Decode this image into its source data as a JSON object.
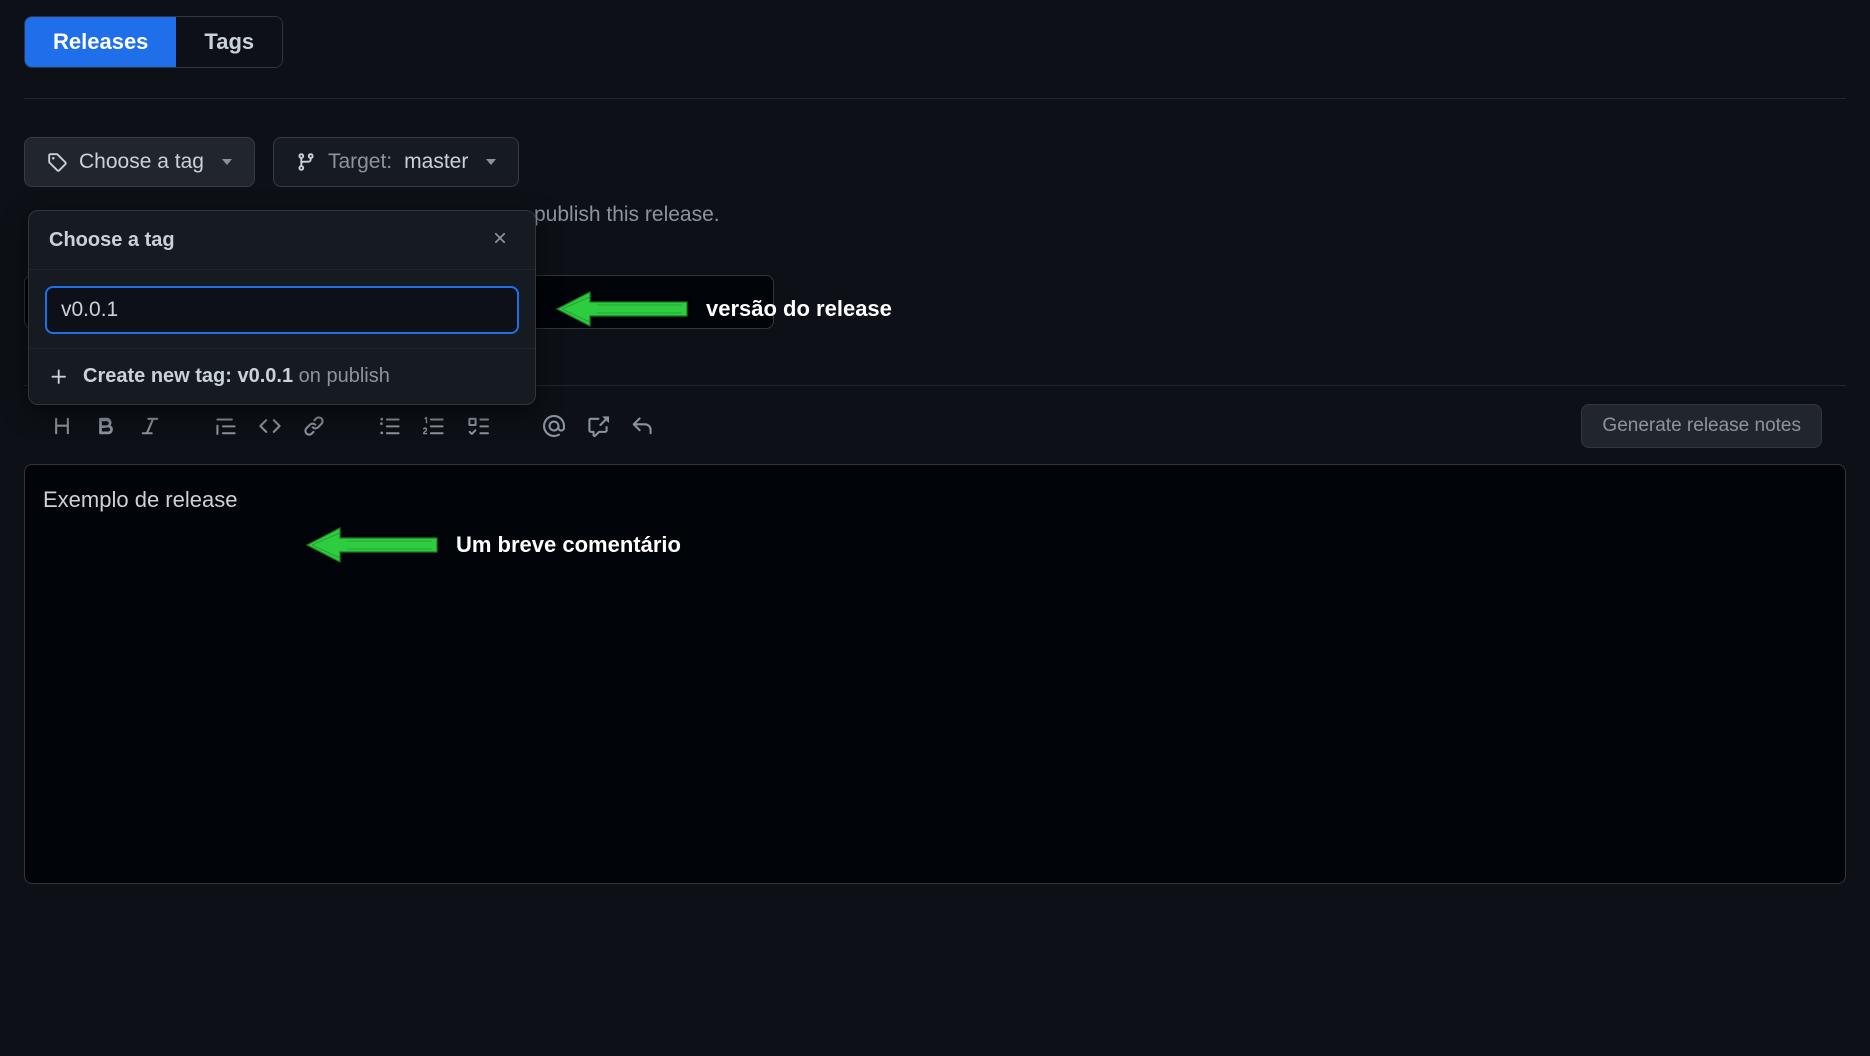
{
  "tabs": {
    "releases": "Releases",
    "tags": "Tags"
  },
  "choose_tag_btn": "Choose a tag",
  "target_label": "Target:",
  "target_value": "master",
  "helper_text": "publish this release.",
  "dropdown": {
    "title": "Choose a tag",
    "input_value": "v0.0.1",
    "create_prefix": "Create new tag:",
    "create_tag": "v0.0.1",
    "create_suffix": "on publish"
  },
  "release_title_value": "",
  "toolbar": {
    "generate": "Generate release notes"
  },
  "editor_value": "Exemplo de release",
  "annotations": {
    "version": "versão do release",
    "comment": "Um breve comentário"
  }
}
